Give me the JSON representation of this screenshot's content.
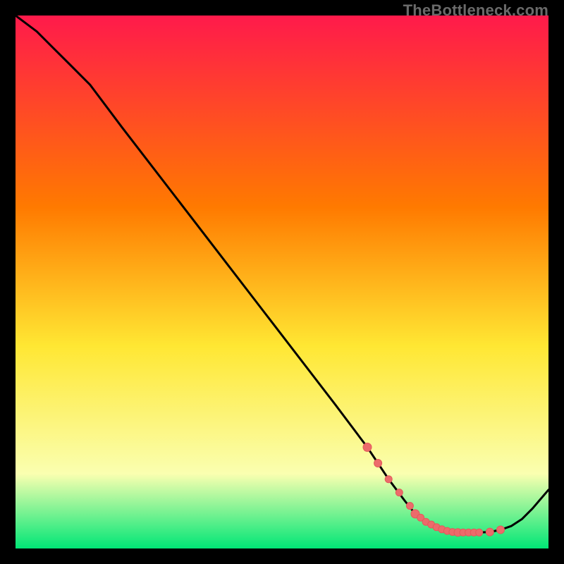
{
  "watermark": "TheBottleneck.com",
  "colors": {
    "frame": "#000000",
    "gradient_top": "#ff1a4b",
    "gradient_mid1": "#ff7a00",
    "gradient_mid2": "#ffe733",
    "gradient_mid3": "#faffb0",
    "gradient_bottom": "#00e676",
    "curve": "#000000",
    "marker_fill": "#ec6b6b",
    "marker_stroke": "#e35a5a"
  },
  "chart_data": {
    "type": "line",
    "title": "",
    "xlabel": "",
    "ylabel": "",
    "xlim": [
      0,
      100
    ],
    "ylim": [
      0,
      100
    ],
    "curve": {
      "x": [
        0,
        4,
        7,
        10,
        14,
        20,
        30,
        40,
        50,
        60,
        66,
        70,
        73,
        75,
        77,
        79,
        81,
        83,
        85,
        87,
        89,
        91,
        93,
        95,
        97,
        100
      ],
      "y": [
        100,
        97,
        94,
        91,
        87,
        79,
        66,
        53,
        40,
        27,
        19,
        13,
        9,
        6.5,
        5,
        4,
        3.3,
        3,
        3,
        3,
        3.1,
        3.5,
        4.2,
        5.5,
        7.5,
        11
      ]
    },
    "markers": {
      "x": [
        66,
        68,
        70,
        72,
        74,
        75,
        76,
        77,
        78,
        79,
        80,
        81,
        82,
        83,
        84,
        85,
        86,
        87,
        89,
        91
      ],
      "y": [
        19,
        16,
        13,
        10.5,
        8,
        6.5,
        5.8,
        5,
        4.5,
        4,
        3.6,
        3.3,
        3.1,
        3,
        3,
        3,
        3,
        3,
        3.1,
        3.5
      ],
      "r": [
        6,
        5.5,
        5,
        5,
        5,
        6,
        5,
        5,
        5,
        5,
        5,
        5,
        5,
        5.5,
        5,
        5,
        5,
        5,
        5.5,
        5.5
      ]
    }
  }
}
